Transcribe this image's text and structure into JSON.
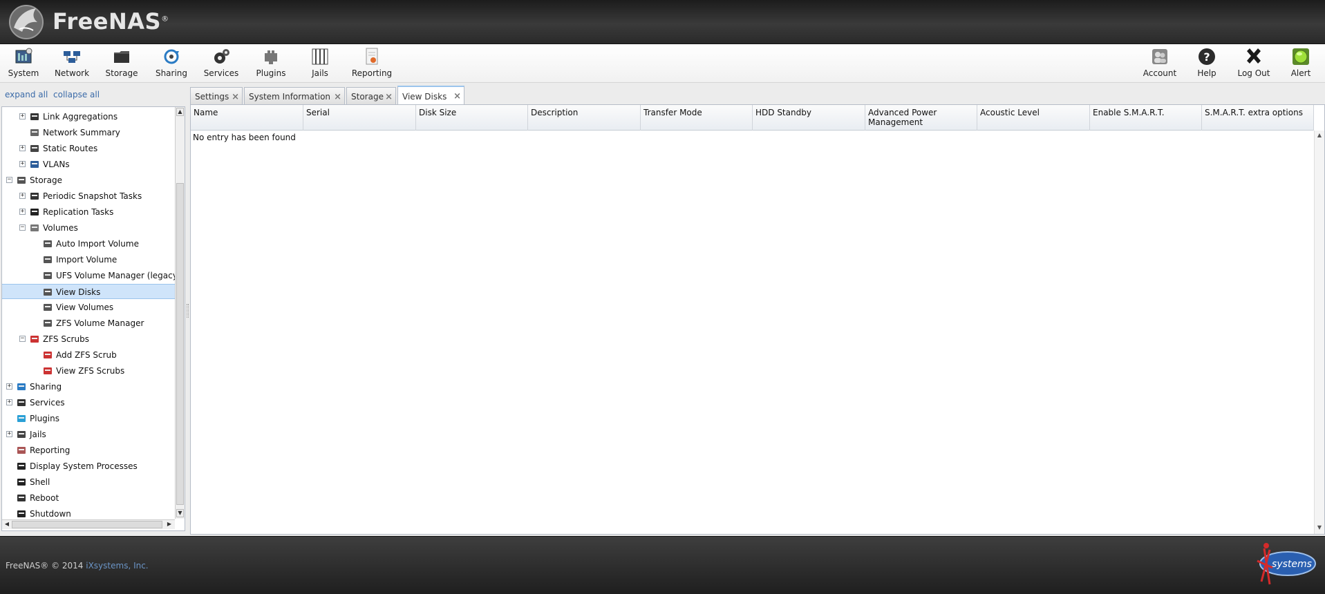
{
  "header": {
    "brand": "FreeNAS",
    "brand_mark": "®"
  },
  "toolbar": {
    "left": [
      {
        "label": "System",
        "icon": "system-icon"
      },
      {
        "label": "Network",
        "icon": "network-icon"
      },
      {
        "label": "Storage",
        "icon": "storage-icon"
      },
      {
        "label": "Sharing",
        "icon": "sharing-icon"
      },
      {
        "label": "Services",
        "icon": "services-icon"
      },
      {
        "label": "Plugins",
        "icon": "plugins-icon"
      },
      {
        "label": "Jails",
        "icon": "jails-icon"
      },
      {
        "label": "Reporting",
        "icon": "reporting-icon"
      }
    ],
    "right": [
      {
        "label": "Account",
        "icon": "account-icon"
      },
      {
        "label": "Help",
        "icon": "help-icon"
      },
      {
        "label": "Log Out",
        "icon": "logout-icon"
      },
      {
        "label": "Alert",
        "icon": "alert-icon"
      }
    ]
  },
  "left_actions": {
    "expand": "expand all",
    "collapse": "collapse all"
  },
  "tree": [
    {
      "label": "Link Aggregations",
      "toggle": "+",
      "icon": "link-aggregation-icon"
    },
    {
      "label": "Network Summary",
      "toggle": "",
      "icon": "wrench-icon"
    },
    {
      "label": "Static Routes",
      "toggle": "+",
      "icon": "static-routes-icon"
    },
    {
      "label": "VLANs",
      "toggle": "+",
      "icon": "vlan-icon"
    },
    {
      "label": "Storage",
      "toggle": "−",
      "icon": "folder-icon"
    },
    {
      "label": "Periodic Snapshot Tasks",
      "toggle": "+",
      "icon": "snapshot-icon"
    },
    {
      "label": "Replication Tasks",
      "toggle": "+",
      "icon": "replication-icon"
    },
    {
      "label": "Volumes",
      "toggle": "−",
      "icon": "volumes-icon"
    },
    {
      "label": "Auto Import Volume",
      "toggle": "",
      "icon": "volume-import-icon"
    },
    {
      "label": "Import Volume",
      "toggle": "",
      "icon": "volume-import-icon"
    },
    {
      "label": "UFS Volume Manager (legacy)",
      "toggle": "",
      "icon": "volume-manager-icon"
    },
    {
      "label": "View Disks",
      "toggle": "",
      "icon": "view-disks-icon"
    },
    {
      "label": "View Volumes",
      "toggle": "",
      "icon": "view-volumes-icon"
    },
    {
      "label": "ZFS Volume Manager",
      "toggle": "",
      "icon": "volume-manager-icon"
    },
    {
      "label": "ZFS Scrubs",
      "toggle": "−",
      "icon": "calendar-icon"
    },
    {
      "label": "Add ZFS Scrub",
      "toggle": "",
      "icon": "calendar-add-icon"
    },
    {
      "label": "View ZFS Scrubs",
      "toggle": "",
      "icon": "calendar-view-icon"
    },
    {
      "label": "Sharing",
      "toggle": "+",
      "icon": "sharing-icon"
    },
    {
      "label": "Services",
      "toggle": "+",
      "icon": "services-icon"
    },
    {
      "label": "Plugins",
      "toggle": "",
      "icon": "plugins-icon"
    },
    {
      "label": "Jails",
      "toggle": "+",
      "icon": "jails-icon"
    },
    {
      "label": "Reporting",
      "toggle": "",
      "icon": "reporting-icon"
    },
    {
      "label": "Display System Processes",
      "toggle": "",
      "icon": "processes-icon"
    },
    {
      "label": "Shell",
      "toggle": "",
      "icon": "shell-icon"
    },
    {
      "label": "Reboot",
      "toggle": "",
      "icon": "reboot-icon"
    },
    {
      "label": "Shutdown",
      "toggle": "",
      "icon": "shutdown-icon"
    }
  ],
  "tabs": [
    {
      "label": "Settings",
      "active": false
    },
    {
      "label": "System Information",
      "active": false
    },
    {
      "label": "Storage",
      "active": false
    },
    {
      "label": "View Disks",
      "active": true
    }
  ],
  "grid": {
    "columns": [
      "Name",
      "Serial",
      "Disk Size",
      "Description",
      "Transfer Mode",
      "HDD Standby",
      "Advanced Power Management",
      "Acoustic Level",
      "Enable S.M.A.R.T.",
      "S.M.A.R.T. extra options"
    ],
    "empty_text": "No entry has been found"
  },
  "footer": {
    "copyright": "FreeNAS® © 2014 ",
    "company": "iXsystems, Inc.",
    "logo_text": "systems"
  },
  "colors": {
    "header_bg": "#2a2a2a",
    "link": "#3a6aa8",
    "selected_row": "#cfe4fa",
    "footer_bg": "#2b2b2b"
  }
}
